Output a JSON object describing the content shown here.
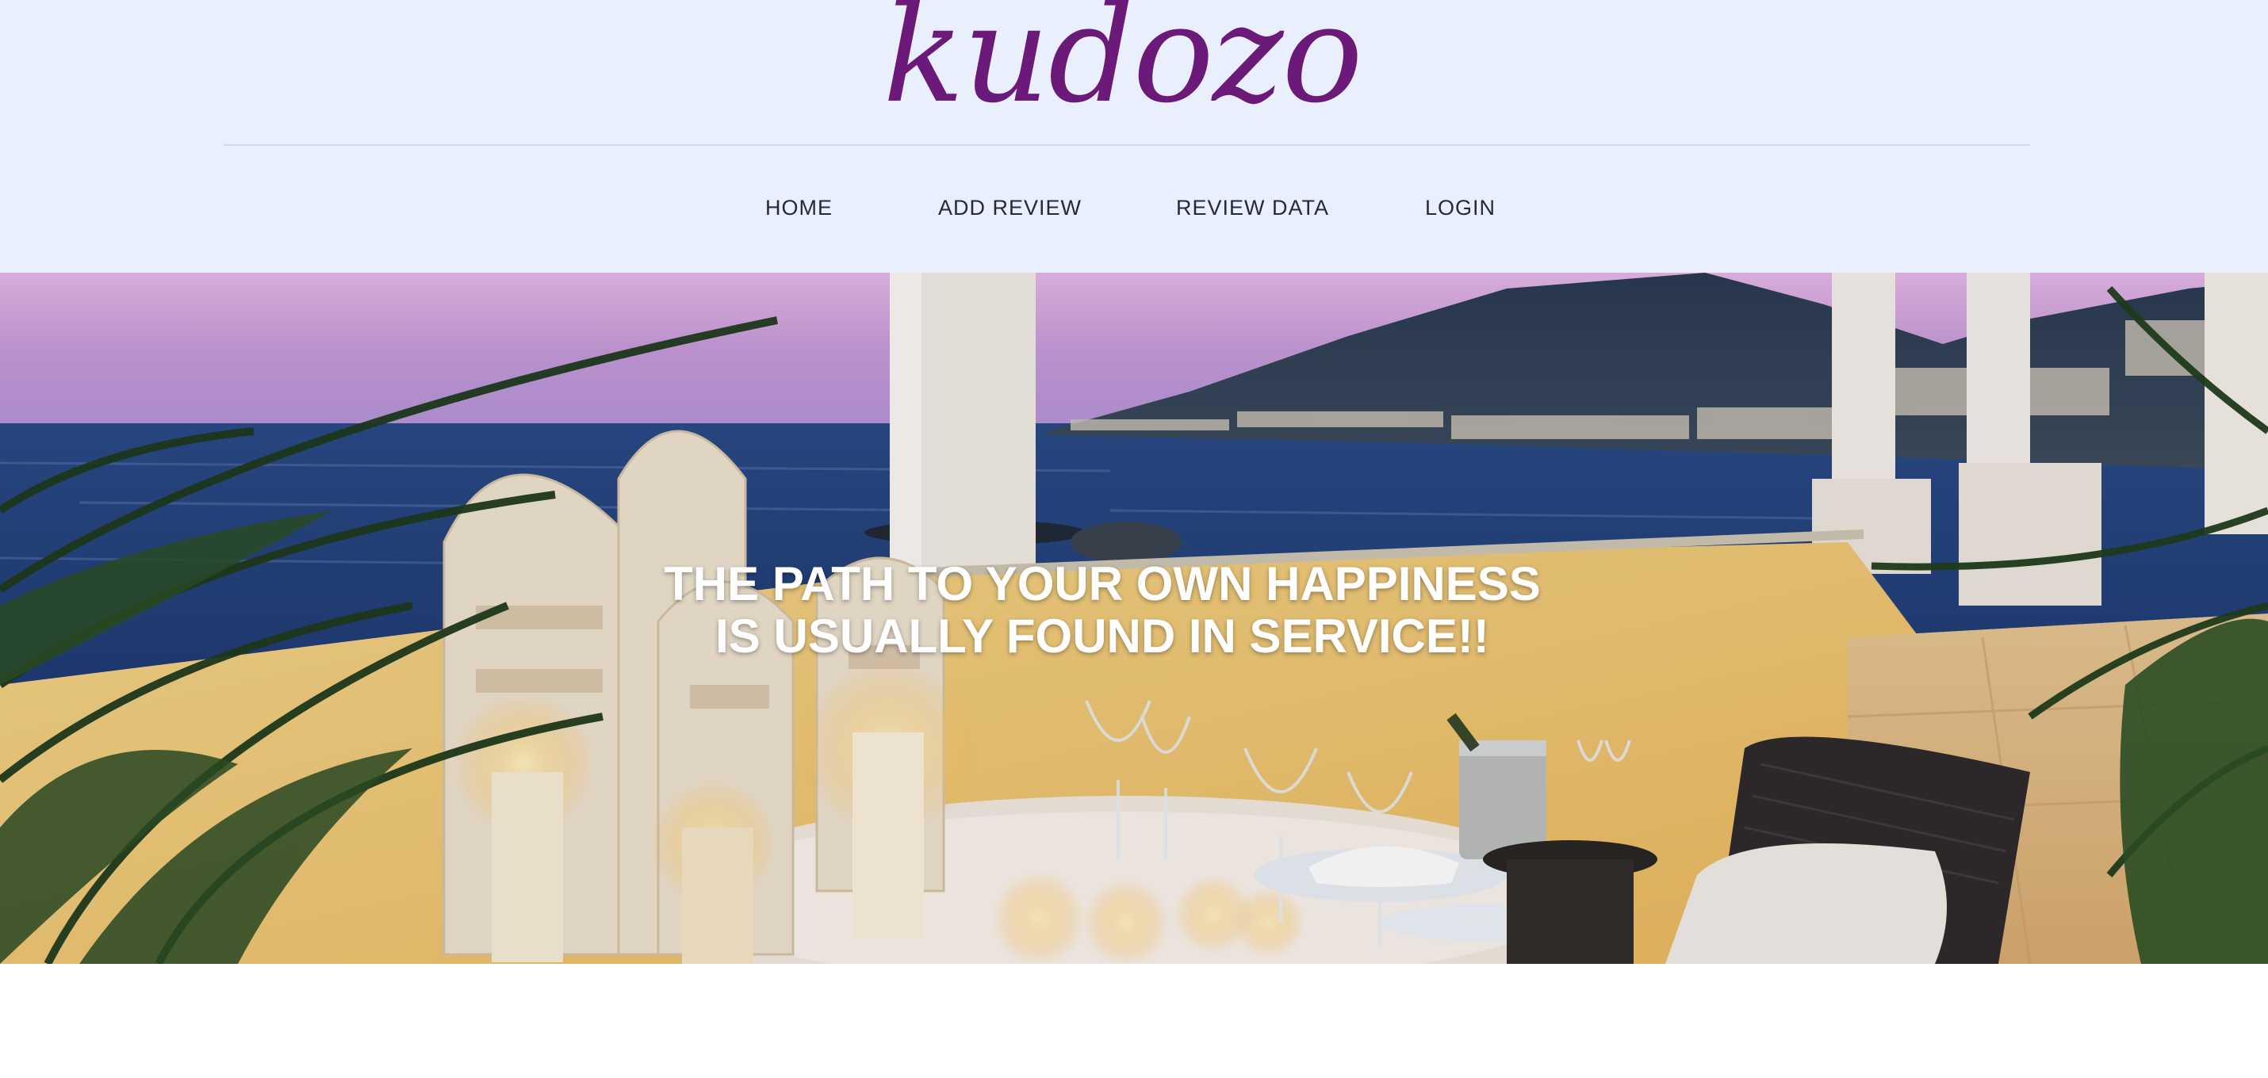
{
  "brand": {
    "logo_text": "kudozo",
    "logo_color": "#6b1a7a",
    "header_bg": "#e9effd"
  },
  "nav": {
    "items": [
      {
        "label": "HOME"
      },
      {
        "label": "ADD REVIEW"
      },
      {
        "label": "REVIEW DATA"
      },
      {
        "label": "LOGIN"
      }
    ]
  },
  "hero": {
    "line1": "THE PATH TO YOUR OWN HAPPINESS",
    "line2": "IS USUALLY FOUND IN SERVICE!!",
    "image_subject": "sunset terrace dining table with candles and lanterns overlooking the sea"
  }
}
